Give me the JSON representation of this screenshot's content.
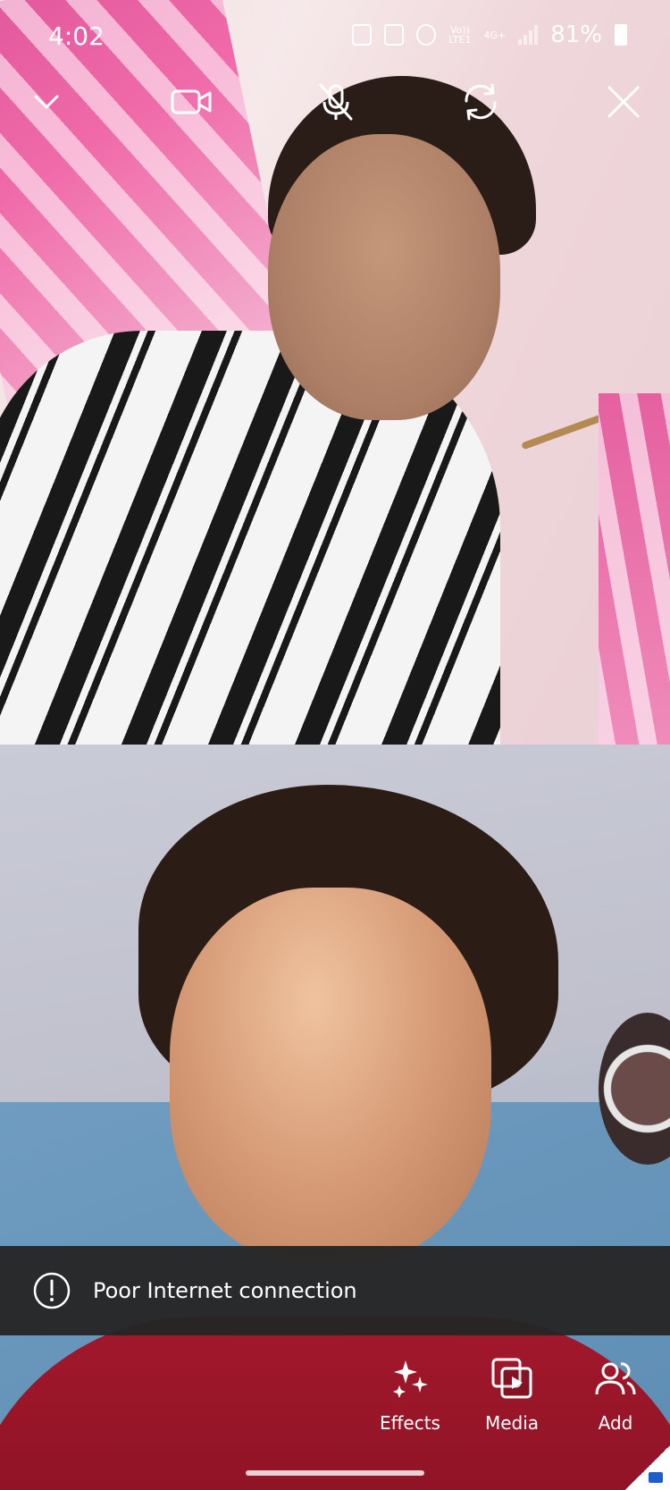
{
  "status_bar": {
    "time": "4:02",
    "network_volte": "Vo))",
    "network_lte": "LTE1",
    "network_4g": "4G+",
    "battery": "81%"
  },
  "call_toolbar": {
    "icons": [
      "chevron-down-icon",
      "video-camera-icon",
      "mic-off-icon",
      "switch-camera-icon",
      "close-icon"
    ]
  },
  "toast": {
    "message": "Poor Internet connection",
    "icon": "alert-circle-icon"
  },
  "bottom_actions": [
    {
      "label": "Effects",
      "icon": "sparkles-icon"
    },
    {
      "label": "Media",
      "icon": "media-icon"
    },
    {
      "label": "Add",
      "icon": "add-people-icon"
    }
  ],
  "colors": {
    "toast_bg": "#252525",
    "text": "#ffffff"
  }
}
